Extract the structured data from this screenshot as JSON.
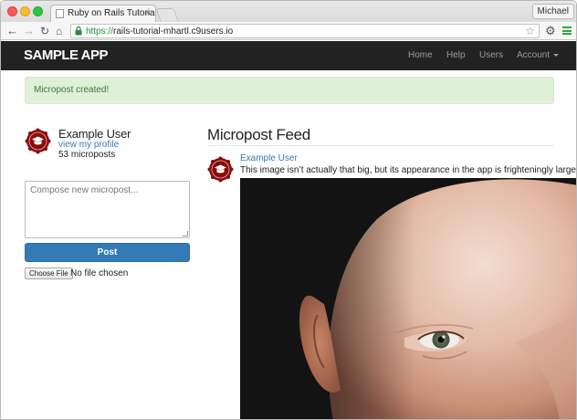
{
  "browser": {
    "tab_title": "Ruby on Rails Tutorial Sam",
    "tab_close": "×",
    "profile": "Michael",
    "url_scheme": "https://",
    "url_host": "rails-tutorial-mhartl.c9users.io",
    "accent": "#1e8e3e"
  },
  "app": {
    "logo": "sample app",
    "nav": {
      "home": "Home",
      "help": "Help",
      "users": "Users",
      "account": "Account"
    },
    "navbar_color": "#222222"
  },
  "flash": {
    "message": "Micropost created!",
    "color": "#dff0d8"
  },
  "sidebar": {
    "user_name": "Example User",
    "profile_link": "view my profile",
    "micropost_count": "53 microposts",
    "composer_placeholder": "Compose new micropost...",
    "post_button": "Post",
    "file_button": "Choose File",
    "file_status": "No file chosen"
  },
  "feed": {
    "title": "Micropost Feed",
    "items": [
      {
        "user": "Example User",
        "content": "This image isn’t actually that big, but its appearance in the app is frighteningly large."
      }
    ]
  },
  "icons": {
    "back": "back-arrow-icon",
    "forward": "forward-arrow-icon",
    "reload": "reload-icon",
    "home": "home-icon",
    "lock": "lock-icon",
    "star": "bookmark-star-icon",
    "settings": "gear-icon",
    "menu": "menu-icon",
    "avatar": "gravatar-icon"
  }
}
